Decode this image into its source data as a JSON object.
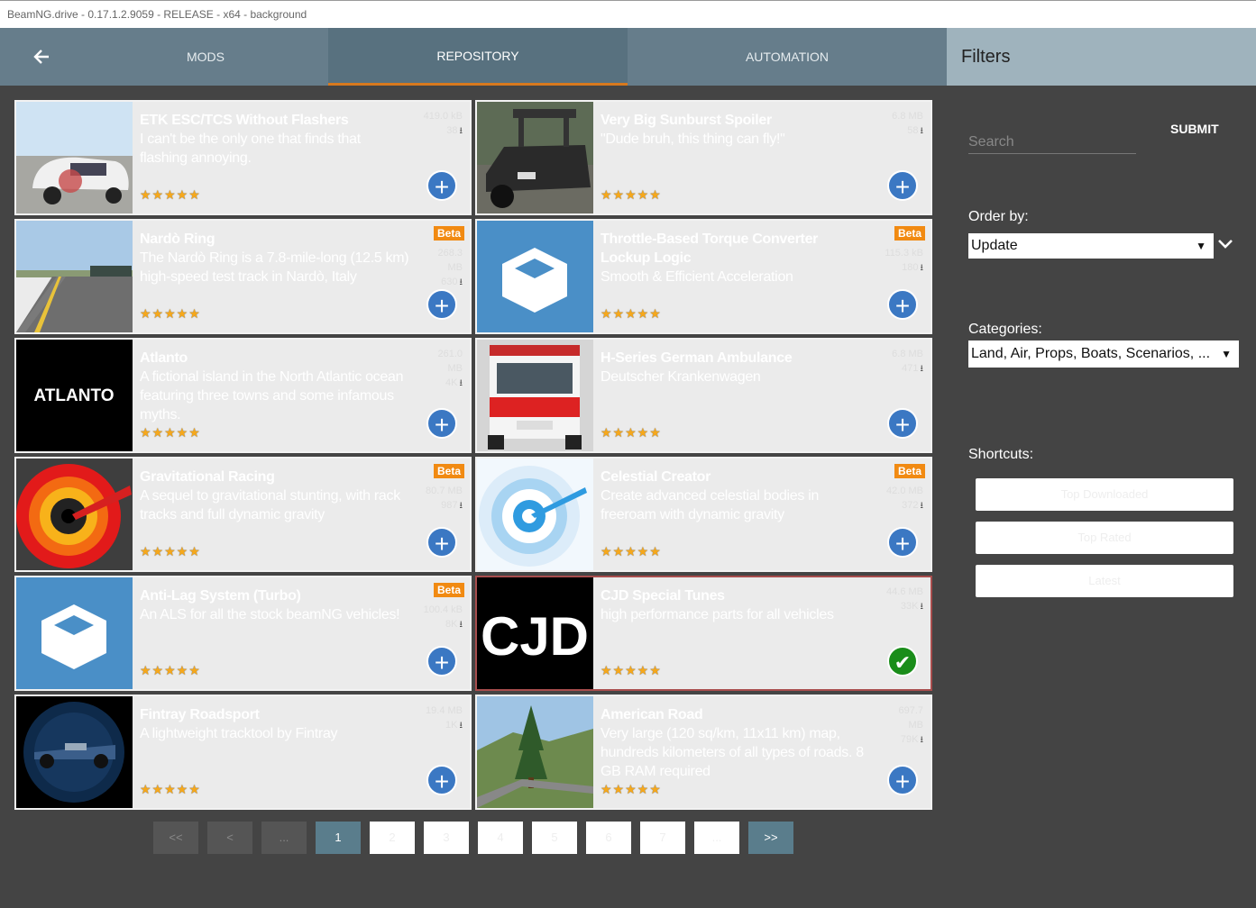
{
  "window": {
    "title": "BeamNG.drive - 0.17.1.2.9059 - RELEASE - x64 - background"
  },
  "nav": {
    "back_icon": "arrow-left-icon",
    "tabs": [
      {
        "label": "MODS"
      },
      {
        "label": "REPOSITORY"
      },
      {
        "label": "AUTOMATION"
      }
    ],
    "filters_title": "Filters"
  },
  "mods": [
    {
      "title": "ETK ESC/TCS Without Flashers",
      "desc": "I can't be the only one that finds that flashing annoying.",
      "size": "419.0 kB",
      "downloads": "38",
      "beta": "",
      "stars": "★★★★★",
      "action": "add"
    },
    {
      "title": "Very Big Sunburst Spoiler",
      "desc": "\"Dude bruh, this thing can fly!\"",
      "size": "6.8 MB",
      "downloads": "58",
      "beta": "",
      "stars": "★★★★★",
      "action": "add"
    },
    {
      "title": "Nardò Ring",
      "desc": "The Nardò Ring is a 7.8-mile-long (12.5 km) high-speed test track in Nardò, Italy",
      "size": "268.3 MB",
      "downloads": "630",
      "beta": "Beta",
      "stars": "★★★★★",
      "action": "add"
    },
    {
      "title": "Throttle-Based Torque Converter Lockup Logic",
      "desc": "Smooth & Efficient Acceleration",
      "size": "115.3 kB",
      "downloads": "180",
      "beta": "Beta",
      "stars": "★★★★★",
      "action": "add"
    },
    {
      "title": "Atlanto",
      "desc": "A fictional island in the North Atlantic ocean featuring three towns and some infamous myths.",
      "size": "261.0 MB",
      "downloads": "4K",
      "beta": "",
      "stars": "★★★★★",
      "action": "add"
    },
    {
      "title": "H-Series German Ambulance",
      "desc": "Deutscher Krankenwagen",
      "size": "6.8 MB",
      "downloads": "471",
      "beta": "",
      "stars": "★★★★★",
      "action": "add"
    },
    {
      "title": "Gravitational Racing",
      "desc": "A sequel to gravitational stunting, with rack tracks and full dynamic gravity",
      "size": "80.7 MB",
      "downloads": "987",
      "beta": "Beta",
      "stars": "★★★★★",
      "action": "add"
    },
    {
      "title": "Celestial Creator",
      "desc": "Create advanced celestial bodies in freeroam with dynamic gravity",
      "size": "42.0 MB",
      "downloads": "372",
      "beta": "Beta",
      "stars": "★★★★★",
      "action": "add"
    },
    {
      "title": "Anti-Lag System (Turbo)",
      "desc": "An ALS for all the stock beamNG vehicles!",
      "size": "100.4 kB",
      "downloads": "8K",
      "beta": "Beta",
      "stars": "★★★★★",
      "action": "add"
    },
    {
      "title": "CJD Special Tunes",
      "desc": "high performance parts for all vehicles",
      "size": "44.6 MB",
      "downloads": "33K",
      "beta": "",
      "stars": "★★★★★",
      "action": "installed"
    },
    {
      "title": "Fintray Roadsport",
      "desc": "A lightweight tracktool by Fintray",
      "size": "19.4 MB",
      "downloads": "1K",
      "beta": "",
      "stars": "★★★★★",
      "action": "add"
    },
    {
      "title": "American Road",
      "desc": "Very large (120 sq/km, 11x11 km) map, hundreds kilometers of all types of roads. 8 GB RAM required",
      "size": "697.7 MB",
      "downloads": "79K",
      "beta": "",
      "stars": "★★★★★",
      "action": "add"
    }
  ],
  "pager": [
    {
      "label": "<<"
    },
    {
      "label": "<"
    },
    {
      "label": "..."
    },
    {
      "label": "1"
    },
    {
      "label": "2"
    },
    {
      "label": "3"
    },
    {
      "label": "4"
    },
    {
      "label": "5"
    },
    {
      "label": "6"
    },
    {
      "label": "7"
    },
    {
      "label": "..."
    },
    {
      "label": ">>"
    }
  ],
  "filters": {
    "search_placeholder": "Search",
    "submit_label": "SUBMIT",
    "order_label": "Order by:",
    "order_value": "Update",
    "categories_label": "Categories:",
    "categories_value": "Land, Air, Props, Boats, Scenarios, ...",
    "shortcuts_label": "Shortcuts:",
    "shortcuts": [
      {
        "label": "Top Downloaded"
      },
      {
        "label": "Top Rated"
      },
      {
        "label": "Latest"
      }
    ]
  },
  "colors": {
    "accent": "#d7791e",
    "beta": "#f18a12",
    "add": "#3b78c3",
    "installed": "#1a8d1a"
  }
}
